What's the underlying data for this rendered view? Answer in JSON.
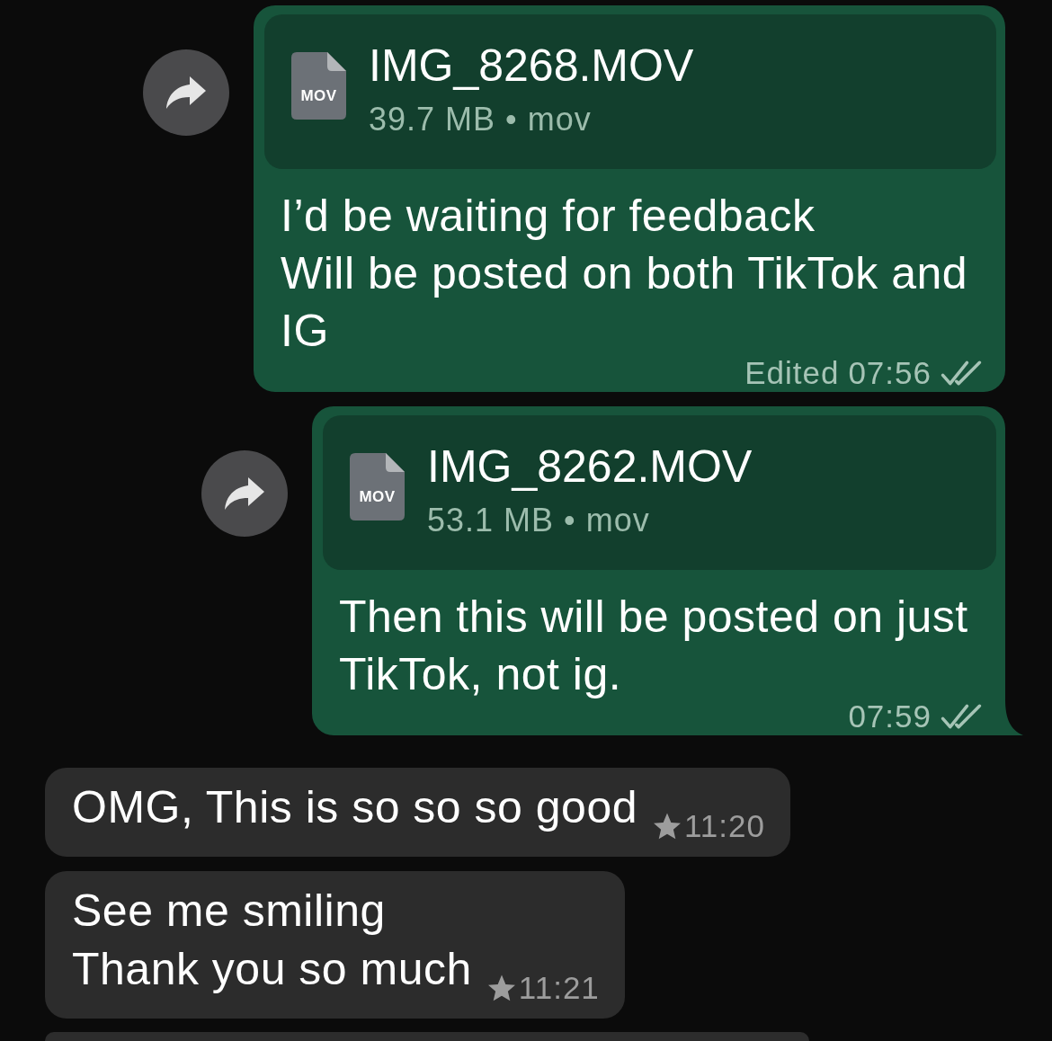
{
  "messages": [
    {
      "kind": "outgoing",
      "forward": true,
      "attachment": {
        "icon_label": "MOV",
        "name": "IMG_8268.MOV",
        "details": "39.7 MB • mov"
      },
      "text": "I’d be waiting for feedback\nWill be posted on both TikTok and IG",
      "edited_label": "Edited",
      "time": "07:56",
      "read": false,
      "starred": false,
      "tail": false
    },
    {
      "kind": "outgoing",
      "forward": true,
      "attachment": {
        "icon_label": "MOV",
        "name": "IMG_8262.MOV",
        "details": "53.1 MB • mov"
      },
      "text": "Then this will be posted on just TikTok, not ig.",
      "time": "07:59",
      "read": false,
      "starred": false,
      "tail": true
    },
    {
      "kind": "incoming",
      "forward": false,
      "text": "OMG, This is so so so good",
      "time": "11:20",
      "starred": true,
      "tail": false
    },
    {
      "kind": "incoming",
      "forward": false,
      "text": "See me smiling\nThank you so much",
      "time": "11:21",
      "starred": true,
      "tail": false
    },
    {
      "kind": "incoming",
      "forward": false,
      "tail": false
    }
  ]
}
